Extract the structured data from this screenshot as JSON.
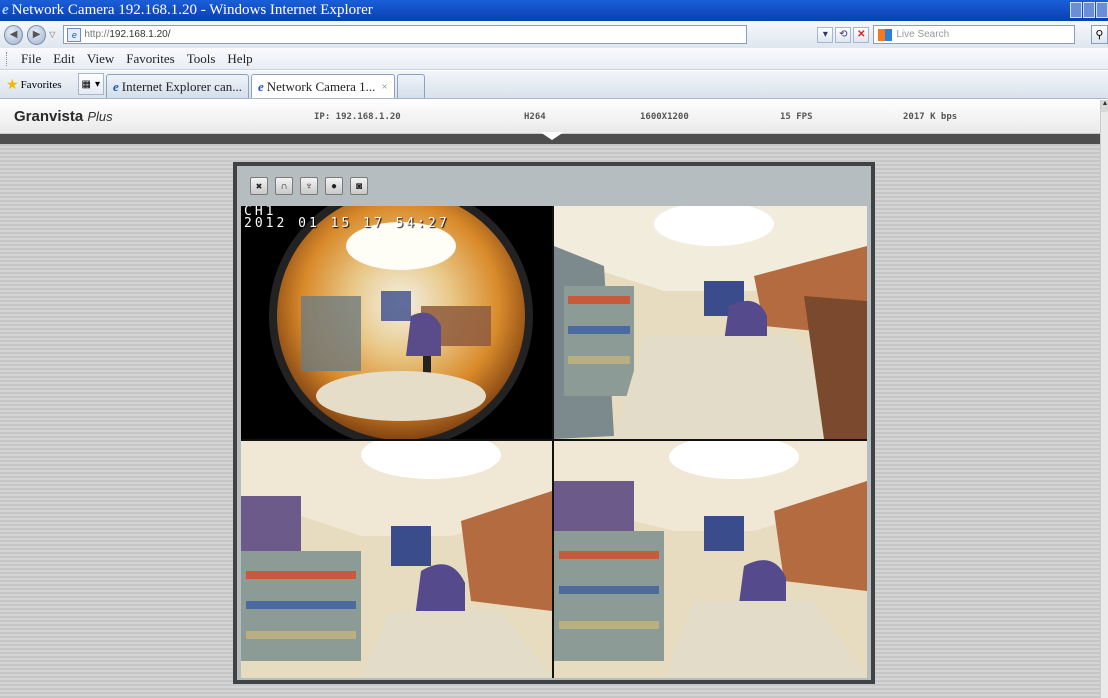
{
  "window": {
    "title": "Network Camera 192.168.1.20 - Windows Internet Explorer"
  },
  "address": {
    "url_prefix": "http://",
    "url_host": "192.168.1.20/",
    "search_placeholder": "Live Search"
  },
  "menu": [
    "File",
    "Edit",
    "View",
    "Favorites",
    "Tools",
    "Help"
  ],
  "favorites_label": "Favorites",
  "tabs": [
    {
      "label": "Internet Explorer can..."
    },
    {
      "label": "Network Camera 1...",
      "close": "×"
    }
  ],
  "camera": {
    "brand": "Granvista",
    "brand_suffix": "Plus",
    "ip": "IP: 192.168.1.20",
    "codec": "H264",
    "resolution": "1600X1200",
    "fps": "15 FPS",
    "bitrate": "2017 K bps"
  },
  "viewer": {
    "tools": [
      {
        "name": "fullscreen-icon",
        "glyph": "✖"
      },
      {
        "name": "headphones-icon",
        "glyph": "∩"
      },
      {
        "name": "microphone-icon",
        "glyph": "♆"
      },
      {
        "name": "record-icon",
        "glyph": "●"
      },
      {
        "name": "snapshot-icon",
        "glyph": "◙"
      }
    ],
    "osd_channel": "CH1",
    "osd_timestamp": "2012 01 15 17 54:27"
  },
  "colors": {
    "title_bar": "#0a3fb0",
    "viewer_frame": "#3f4345",
    "viewer_bg": "#b5bdc0"
  }
}
